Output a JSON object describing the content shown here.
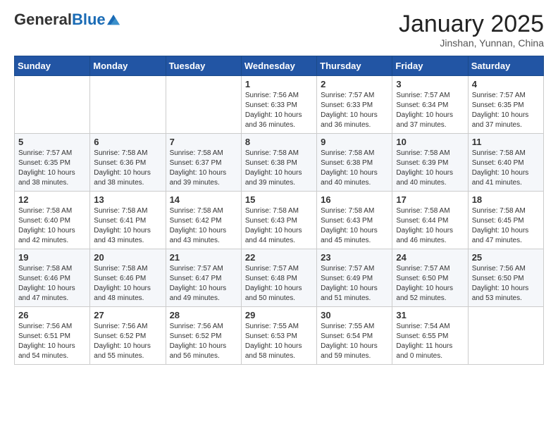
{
  "header": {
    "logo_general": "General",
    "logo_blue": "Blue",
    "title": "January 2025",
    "subtitle": "Jinshan, Yunnan, China"
  },
  "days_of_week": [
    "Sunday",
    "Monday",
    "Tuesday",
    "Wednesday",
    "Thursday",
    "Friday",
    "Saturday"
  ],
  "weeks": [
    [
      {
        "day": "",
        "info": ""
      },
      {
        "day": "",
        "info": ""
      },
      {
        "day": "",
        "info": ""
      },
      {
        "day": "1",
        "info": "Sunrise: 7:56 AM\nSunset: 6:33 PM\nDaylight: 10 hours\nand 36 minutes."
      },
      {
        "day": "2",
        "info": "Sunrise: 7:57 AM\nSunset: 6:33 PM\nDaylight: 10 hours\nand 36 minutes."
      },
      {
        "day": "3",
        "info": "Sunrise: 7:57 AM\nSunset: 6:34 PM\nDaylight: 10 hours\nand 37 minutes."
      },
      {
        "day": "4",
        "info": "Sunrise: 7:57 AM\nSunset: 6:35 PM\nDaylight: 10 hours\nand 37 minutes."
      }
    ],
    [
      {
        "day": "5",
        "info": "Sunrise: 7:57 AM\nSunset: 6:35 PM\nDaylight: 10 hours\nand 38 minutes."
      },
      {
        "day": "6",
        "info": "Sunrise: 7:58 AM\nSunset: 6:36 PM\nDaylight: 10 hours\nand 38 minutes."
      },
      {
        "day": "7",
        "info": "Sunrise: 7:58 AM\nSunset: 6:37 PM\nDaylight: 10 hours\nand 39 minutes."
      },
      {
        "day": "8",
        "info": "Sunrise: 7:58 AM\nSunset: 6:38 PM\nDaylight: 10 hours\nand 39 minutes."
      },
      {
        "day": "9",
        "info": "Sunrise: 7:58 AM\nSunset: 6:38 PM\nDaylight: 10 hours\nand 40 minutes."
      },
      {
        "day": "10",
        "info": "Sunrise: 7:58 AM\nSunset: 6:39 PM\nDaylight: 10 hours\nand 40 minutes."
      },
      {
        "day": "11",
        "info": "Sunrise: 7:58 AM\nSunset: 6:40 PM\nDaylight: 10 hours\nand 41 minutes."
      }
    ],
    [
      {
        "day": "12",
        "info": "Sunrise: 7:58 AM\nSunset: 6:40 PM\nDaylight: 10 hours\nand 42 minutes."
      },
      {
        "day": "13",
        "info": "Sunrise: 7:58 AM\nSunset: 6:41 PM\nDaylight: 10 hours\nand 43 minutes."
      },
      {
        "day": "14",
        "info": "Sunrise: 7:58 AM\nSunset: 6:42 PM\nDaylight: 10 hours\nand 43 minutes."
      },
      {
        "day": "15",
        "info": "Sunrise: 7:58 AM\nSunset: 6:43 PM\nDaylight: 10 hours\nand 44 minutes."
      },
      {
        "day": "16",
        "info": "Sunrise: 7:58 AM\nSunset: 6:43 PM\nDaylight: 10 hours\nand 45 minutes."
      },
      {
        "day": "17",
        "info": "Sunrise: 7:58 AM\nSunset: 6:44 PM\nDaylight: 10 hours\nand 46 minutes."
      },
      {
        "day": "18",
        "info": "Sunrise: 7:58 AM\nSunset: 6:45 PM\nDaylight: 10 hours\nand 47 minutes."
      }
    ],
    [
      {
        "day": "19",
        "info": "Sunrise: 7:58 AM\nSunset: 6:46 PM\nDaylight: 10 hours\nand 47 minutes."
      },
      {
        "day": "20",
        "info": "Sunrise: 7:58 AM\nSunset: 6:46 PM\nDaylight: 10 hours\nand 48 minutes."
      },
      {
        "day": "21",
        "info": "Sunrise: 7:57 AM\nSunset: 6:47 PM\nDaylight: 10 hours\nand 49 minutes."
      },
      {
        "day": "22",
        "info": "Sunrise: 7:57 AM\nSunset: 6:48 PM\nDaylight: 10 hours\nand 50 minutes."
      },
      {
        "day": "23",
        "info": "Sunrise: 7:57 AM\nSunset: 6:49 PM\nDaylight: 10 hours\nand 51 minutes."
      },
      {
        "day": "24",
        "info": "Sunrise: 7:57 AM\nSunset: 6:50 PM\nDaylight: 10 hours\nand 52 minutes."
      },
      {
        "day": "25",
        "info": "Sunrise: 7:56 AM\nSunset: 6:50 PM\nDaylight: 10 hours\nand 53 minutes."
      }
    ],
    [
      {
        "day": "26",
        "info": "Sunrise: 7:56 AM\nSunset: 6:51 PM\nDaylight: 10 hours\nand 54 minutes."
      },
      {
        "day": "27",
        "info": "Sunrise: 7:56 AM\nSunset: 6:52 PM\nDaylight: 10 hours\nand 55 minutes."
      },
      {
        "day": "28",
        "info": "Sunrise: 7:56 AM\nSunset: 6:52 PM\nDaylight: 10 hours\nand 56 minutes."
      },
      {
        "day": "29",
        "info": "Sunrise: 7:55 AM\nSunset: 6:53 PM\nDaylight: 10 hours\nand 58 minutes."
      },
      {
        "day": "30",
        "info": "Sunrise: 7:55 AM\nSunset: 6:54 PM\nDaylight: 10 hours\nand 59 minutes."
      },
      {
        "day": "31",
        "info": "Sunrise: 7:54 AM\nSunset: 6:55 PM\nDaylight: 11 hours\nand 0 minutes."
      },
      {
        "day": "",
        "info": ""
      }
    ]
  ]
}
